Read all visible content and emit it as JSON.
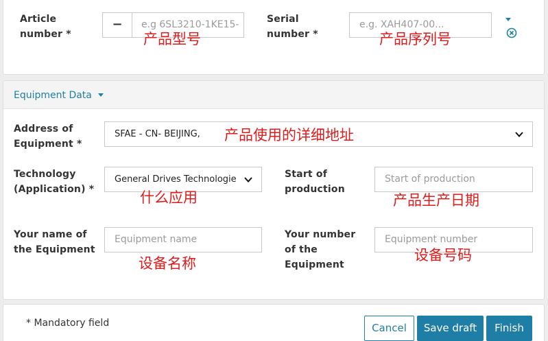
{
  "article": {
    "label": "Article number *",
    "toggle_symbol": "−",
    "placeholder": "e.g 6SL3210-1KE15-",
    "note": "产品型号"
  },
  "serial": {
    "label": "Serial number *",
    "placeholder": "e.g. XAH407-00...",
    "note": "产品序列号"
  },
  "section": {
    "title": "Equipment Data"
  },
  "address": {
    "label": "Address of Equipment *",
    "value": "SFAE - CN- BEIJING,",
    "note": "产品使用的详细地址"
  },
  "technology": {
    "label": "Technology (Application) *",
    "value": "General Drives Technologie",
    "note": "什么应用"
  },
  "start_production": {
    "label": "Start of production",
    "placeholder": "Start of production",
    "note": "产品生产日期"
  },
  "equipment_name": {
    "label": "Your name of the Equipment",
    "placeholder": "Equipment name",
    "note": "设备名称"
  },
  "equipment_number": {
    "label": "Your number of the Equipment",
    "placeholder": "Equipment number",
    "note": "设备号码"
  },
  "footer": {
    "mandatory": "* Mandatory field",
    "cancel": "Cancel",
    "save_draft": "Save draft",
    "finish": "Finish"
  },
  "colors": {
    "accent": "#1f7ea5",
    "annotation": "#e11b1b"
  }
}
